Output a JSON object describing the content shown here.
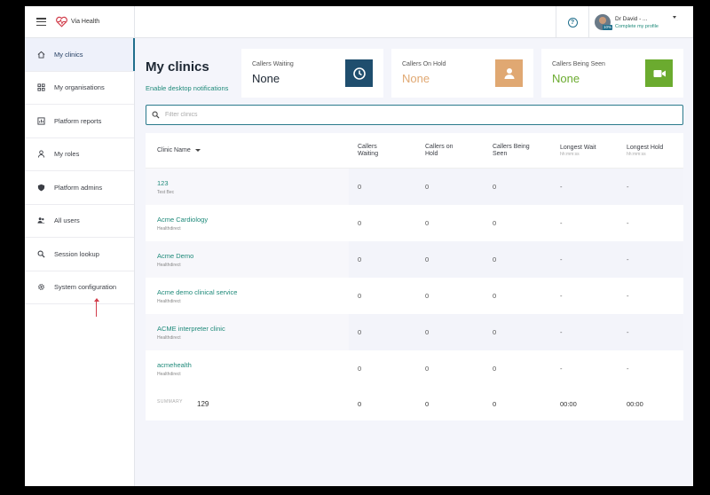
{
  "brand": {
    "name": "Via Health",
    "heart_color": "#d13c4a"
  },
  "sidebar": {
    "items": [
      {
        "label": "My clinics",
        "icon": "home-icon",
        "active": true
      },
      {
        "label": "My organisations",
        "icon": "grid-icon"
      },
      {
        "label": "Platform reports",
        "icon": "chart-icon"
      },
      {
        "label": "My roles",
        "icon": "person-icon"
      },
      {
        "label": "Platform admins",
        "icon": "shield-icon"
      },
      {
        "label": "All users",
        "icon": "users-icon"
      },
      {
        "label": "Session lookup",
        "icon": "search-icon"
      },
      {
        "label": "System configuration",
        "icon": "gear-icon"
      }
    ]
  },
  "header": {
    "help_glyph": "?",
    "profile": {
      "name": "Dr David - ...",
      "link": "Complete my profile",
      "avatar_badge": "10%"
    }
  },
  "page": {
    "title": "My clinics",
    "notifications_link": "Enable desktop notifications"
  },
  "stats": [
    {
      "label": "Callers Waiting",
      "value": "None",
      "value_color": "#1d2733",
      "icon": "clock-icon",
      "icon_bg": "#1f4e6e"
    },
    {
      "label": "Callers On Hold",
      "value": "None",
      "value_color": "#e0a872",
      "icon": "person-icon",
      "icon_bg": "#e0a872"
    },
    {
      "label": "Callers Being Seen",
      "value": "None",
      "value_color": "#6bab2f",
      "icon": "video-icon",
      "icon_bg": "#6bab2f"
    }
  ],
  "filter": {
    "placeholder": "Filter clinics",
    "value": ""
  },
  "table": {
    "columns": [
      {
        "label": "Clinic Name",
        "sub": ""
      },
      {
        "label": "Callers\nWaiting",
        "sub": ""
      },
      {
        "label": "Callers on\nHold",
        "sub": ""
      },
      {
        "label": "Callers Being\nSeen",
        "sub": ""
      },
      {
        "label": "Longest Wait",
        "sub": "hh:mm:ss"
      },
      {
        "label": "Longest Hold",
        "sub": "hh:mm:ss"
      }
    ],
    "rows": [
      {
        "name": "123",
        "org": "Test Bec",
        "waiting": "0",
        "hold": "0",
        "seen": "0",
        "wait": "-",
        "holdtime": "-"
      },
      {
        "name": "Acme Cardiology",
        "org": "Healthdirect",
        "waiting": "0",
        "hold": "0",
        "seen": "0",
        "wait": "-",
        "holdtime": "-"
      },
      {
        "name": "Acme Demo",
        "org": "Healthdirect",
        "waiting": "0",
        "hold": "0",
        "seen": "0",
        "wait": "-",
        "holdtime": "-"
      },
      {
        "name": "Acme demo clinical service",
        "org": "Healthdirect",
        "waiting": "0",
        "hold": "0",
        "seen": "0",
        "wait": "-",
        "holdtime": "-"
      },
      {
        "name": "ACME interpreter clinic",
        "org": "Healthdirect",
        "waiting": "0",
        "hold": "0",
        "seen": "0",
        "wait": "-",
        "holdtime": "-"
      },
      {
        "name": "acmehealth",
        "org": "Healthdirect",
        "waiting": "0",
        "hold": "0",
        "seen": "0",
        "wait": "-",
        "holdtime": "-"
      }
    ],
    "summary": {
      "label": "SUMMARY",
      "count": "129",
      "waiting": "0",
      "hold": "0",
      "seen": "0",
      "wait": "00:00",
      "holdtime": "00:00"
    }
  }
}
